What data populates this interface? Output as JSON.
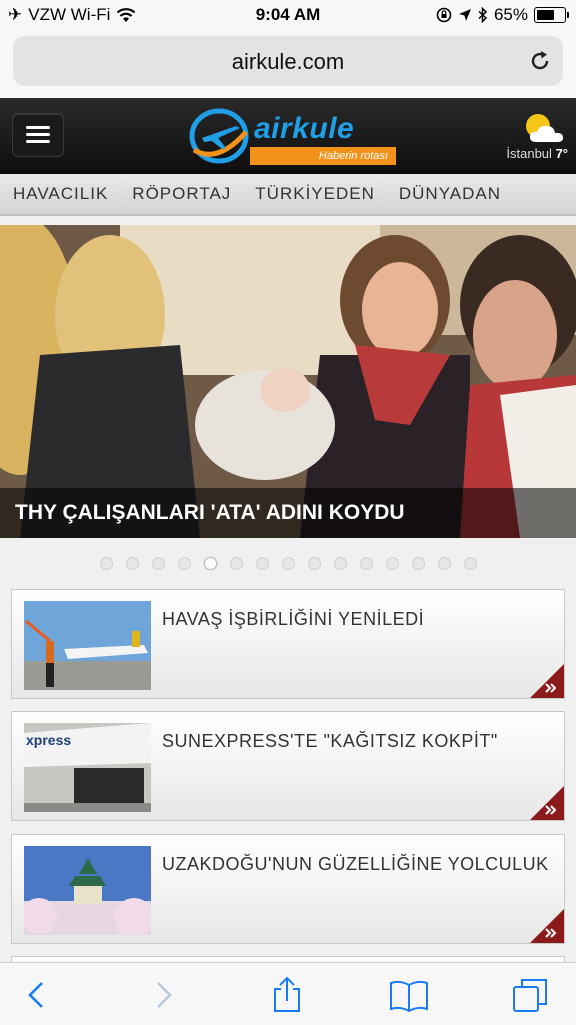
{
  "status_bar": {
    "carrier": "VZW Wi-Fi",
    "time": "9:04 AM",
    "battery": "65%",
    "battery_level": 0.65
  },
  "browser": {
    "url": "airkule.com"
  },
  "site": {
    "logo_text": "airkule",
    "tagline": "Haberin rotası",
    "weather_city": "İstanbul",
    "weather_temp": "7°",
    "brand_blue": "#1e9fe6",
    "brand_orange": "#f2921b"
  },
  "nav": {
    "items": [
      "HAVACILIK",
      "RÖPORTAJ",
      "TÜRKİYEDEN",
      "DÜNYADAN"
    ]
  },
  "hero": {
    "caption": "THY ÇALIŞANLARI 'ATA' ADINI KOYDU"
  },
  "slider": {
    "total": 15,
    "active": 5
  },
  "news": [
    {
      "title": "HAVAŞ İŞBİRLİĞİNİ YENİLEDİ"
    },
    {
      "title": "SUNEXPRESS'TE \"KAĞITSIZ KOKPİT\""
    },
    {
      "title": "UZAKDOĞU'NUN GÜZELLİĞİNE YOLCULUK"
    }
  ],
  "accent_red": "#8b1a1a"
}
